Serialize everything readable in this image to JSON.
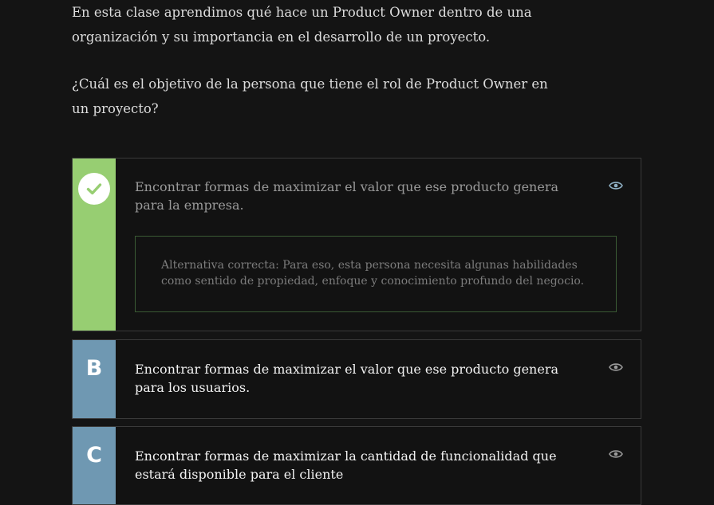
{
  "intro": {
    "paragraph1": "En esta clase aprendimos qué hace un Product Owner dentro de una organización y su importancia en el desarrollo de un proyecto.",
    "question": "¿Cuál es el objetivo de la persona que tiene el rol de Product Owner en un proyecto?"
  },
  "options": [
    {
      "marker": "check-icon",
      "status": "correct",
      "text": "Encontrar formas de maximizar el valor que ese producto genera para la empresa.",
      "feedback": "Alternativa correcta: Para eso, esta persona necesita algunas habilidades como sentido de propiedad, enfoque y conocimiento profundo del negocio.",
      "stripe_color": "#97ce72"
    },
    {
      "marker": "B",
      "text": "Encontrar formas de maximizar el valor que ese producto genera para los usuarios.",
      "stripe_color": "#6f98b2"
    },
    {
      "marker": "C",
      "text": "Encontrar formas de maximizar la cantidad de funcionalidad que estará disponible para el cliente",
      "stripe_color": "#6f98b2"
    }
  ],
  "icons": {
    "reveal": "eye-icon",
    "correct": "check-icon"
  },
  "colors": {
    "background": "#141414",
    "correct_accent": "#97ce72",
    "option_accent": "#6f98b2",
    "feedback_border": "#3a5a34"
  }
}
